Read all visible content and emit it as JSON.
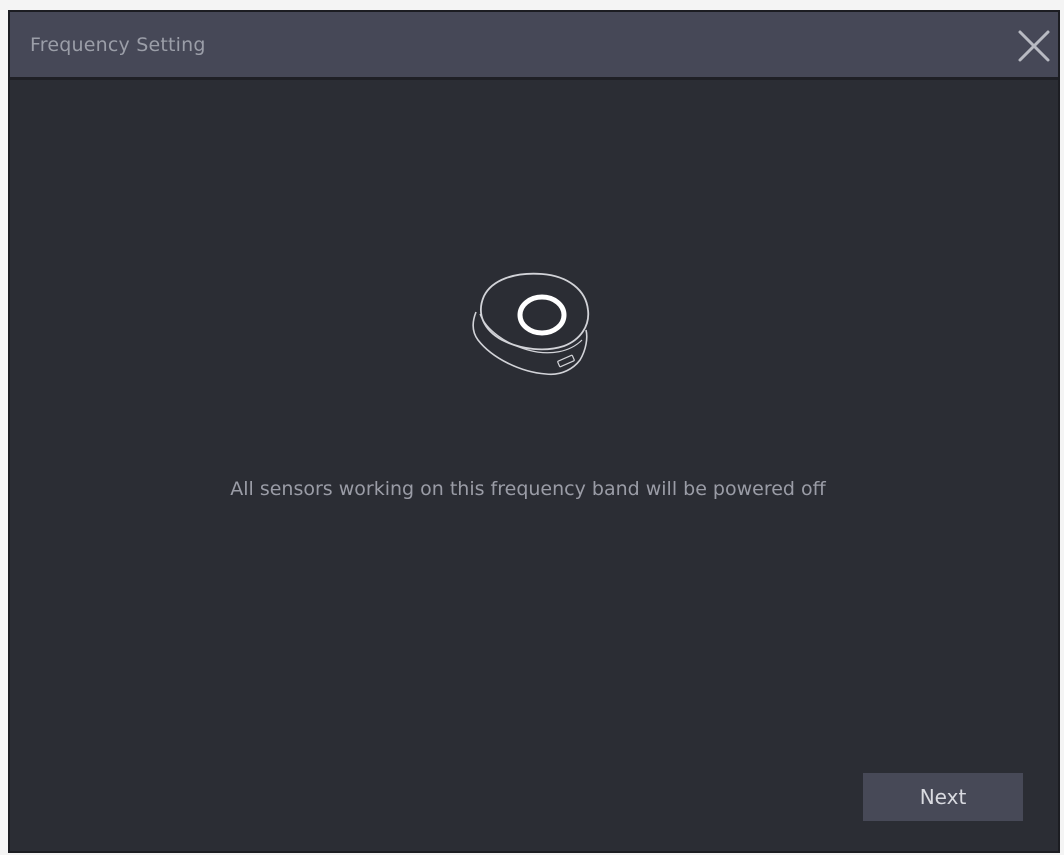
{
  "dialog": {
    "title": "Frequency Setting",
    "close_icon": "close-icon",
    "illustration_icon": "sensor-device-icon",
    "message": "All sensors working on this frequency band will be powered off",
    "next_label": "Next"
  },
  "colors": {
    "dialog_background": "#2b2d34",
    "titlebar_background": "#464857",
    "button_background": "#474957",
    "text_muted": "#9a9ca6"
  }
}
